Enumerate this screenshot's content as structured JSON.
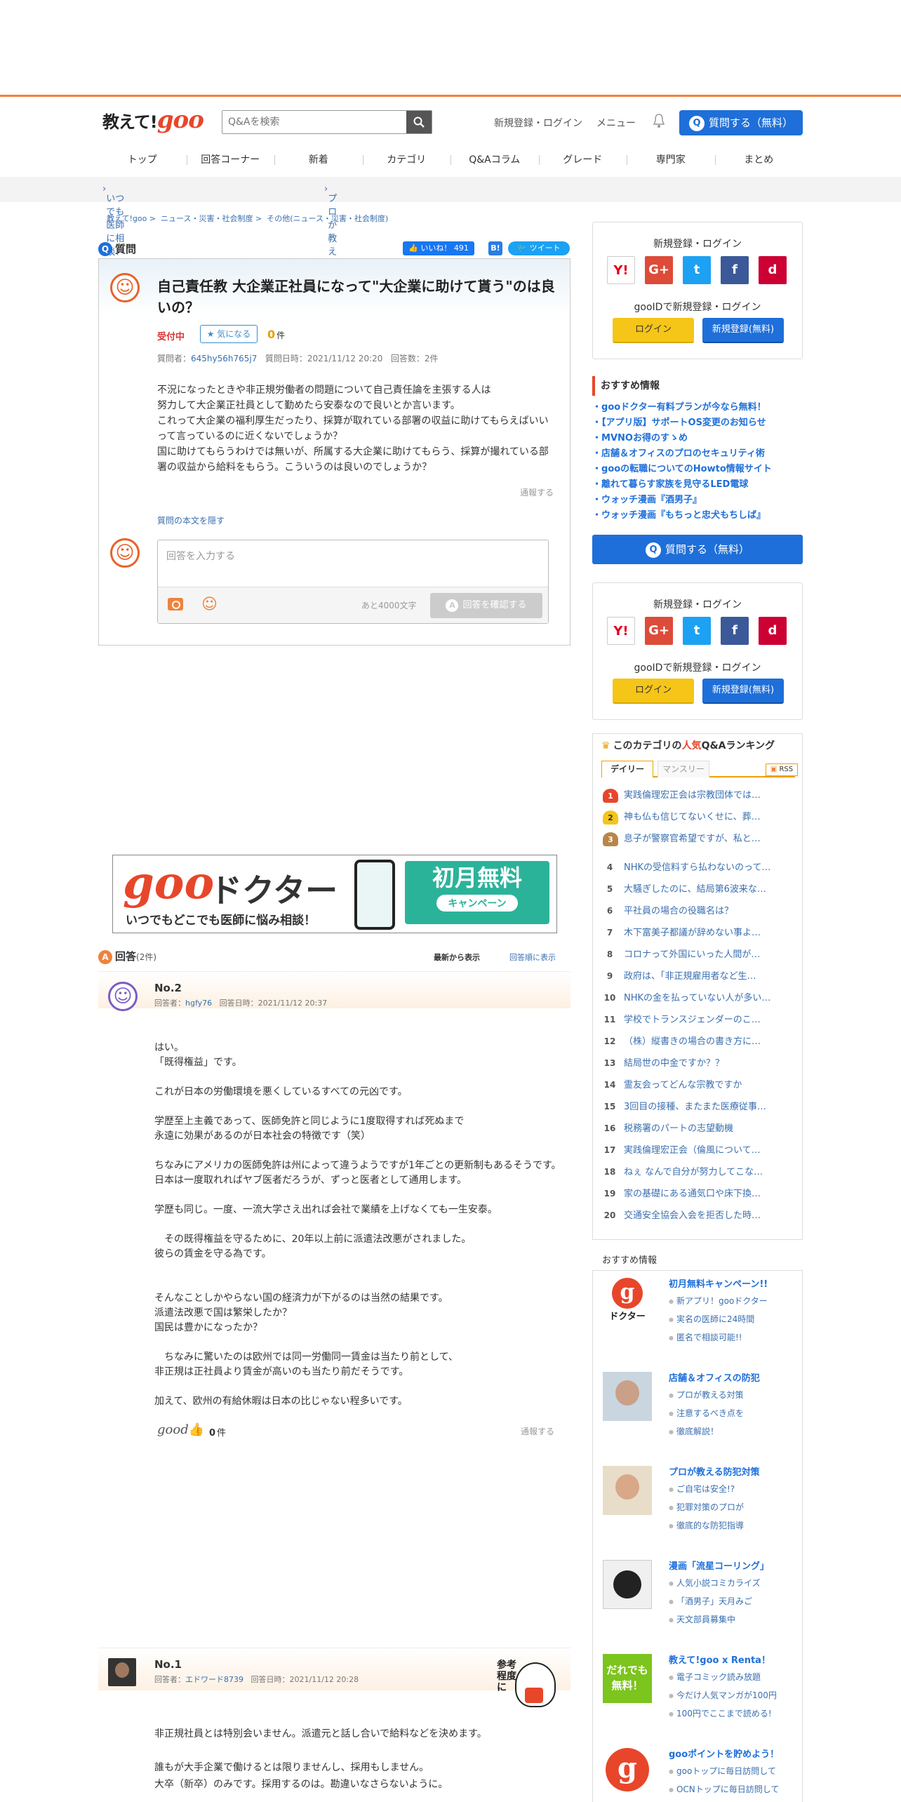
{
  "header": {
    "logo_part1": "教えて!",
    "logo_part2": "goo",
    "search_placeholder": "Q&Aを検索",
    "signup_login": "新規登録・ログイン",
    "menu": "メニュー",
    "ask_button": "質問する（無料）",
    "ask_icon": "Q"
  },
  "nav": [
    "トップ",
    "回答コーナー",
    "新着",
    "カテゴリ",
    "Q&Aコラム",
    "グレード",
    "専門家",
    "まとめ"
  ],
  "subbar": {
    "link1": "いつでも医師に相談、gooドクター",
    "link2": "プロが教える店舗＆オフィスのセキュリティ対策術"
  },
  "breadcrumb": {
    "home": "教えて!goo",
    "cat1": "ニュース・災害・社会制度",
    "cat2": "その他(ニュース・災害・社会制度)",
    "sep": ">"
  },
  "question": {
    "label": "質問",
    "icon": "Q",
    "like_label": "いいね！",
    "like_count": "491",
    "hatena": "B!",
    "tweet": "ツイート",
    "title": "自己責任教 大企業正社員になって\"大企業に助けて貰う\"のは良いの？",
    "status": "受付中",
    "fav_label": "気になる",
    "fav_count": "0",
    "fav_unit": "件",
    "meta_asker_label": "質問者：",
    "meta_asker": "645hy56h765j7",
    "meta_date": "質問日時：2021/11/12 20:20",
    "meta_answers": "回答数：2件",
    "body": "不況になったときや非正規労働者の問題について自己責任論を主張する人は\n努力して大企業正社員として勤めたら安泰なので良いとか言います。\nこれって大企業の福利厚生だったり、採算が取れている部署の収益に助けてもらえばいいって言っているのに近くないでしょうか？\n国に助けてもらうわけでは無いが、所属する大企業に助けてもらう、採算が撮れている部署の収益から給料をもらう。こういうのは良いのでしょうか？",
    "report": "通報する",
    "hide_body": "質問の本文を隠す",
    "answer_placeholder": "回答を入力する",
    "remaining": "あと4000文字",
    "confirm_icon": "A",
    "confirm": "回答を確認する"
  },
  "banner": {
    "brand": "goo",
    "title": "ドクター",
    "tagline": "いつでもどこでも医師に悩み相談！",
    "free": "初月無料",
    "campaign": "キャンペーン"
  },
  "answers": {
    "label": "回答",
    "icon": "A",
    "count": "(2件)",
    "sort_new": "最新から表示",
    "sort_old": "回答順に表示",
    "items": [
      {
        "no": "No.2",
        "answerer_label": "回答者：",
        "answerer": "hgfy76",
        "date": "回答日時：2021/11/12 20:37",
        "body": "はい。\n「既得権益」です。\n\nこれが日本の労働環境を悪くしているすべての元凶です。\n\n学歴至上主義であって、医師免許と同じように1度取得すれば死ぬまで\n永遠に効果があるのが日本社会の特徴です（笑）\n\nちなみにアメリカの医師免許は州によって違うようですが1年ごとの更新制もあるそうです。日本は一度取れればヤブ医者だろうが、ずっと医者として通用します。\n\n学歴も同じ。一度、一流大学さえ出れば会社で業績を上げなくても一生安泰。\n\n　その既得権益を守るために、20年以上前に派遣法改悪がされました。\n彼らの賃金を守る為です。\n\n\nそんなことしかやらない国の経済力が下がるのは当然の結果です。\n派遣法改悪で国は繁栄したか？\n国民は豊かになったか？\n\n　ちなみに驚いたのは欧州では同一労働同一賃金は当たり前として、\n非正規は正社員より賃金が高いのも当たり前だそうです。\n\n加えて、欧州の有給休暇は日本の比じゃない程多いです。",
        "good": "good",
        "good_count": "0",
        "good_unit": "件",
        "report": "通報する"
      },
      {
        "no": "No.1",
        "answerer_label": "回答者：",
        "answerer": "エドワード8739",
        "date": "回答日時：2021/11/12 20:28",
        "stamp": "参考程度に",
        "body": "非正規社員とは特別会いません。派遣元と話し合いで給料などを決めます。\n\n誰もが大手企業で働けるとは限りませんし、採用もしません。\n大卒（新卒）のみです。採用するのは。勘違いなさらないように。"
      }
    ]
  },
  "side": {
    "login_title": "新規登録・ログイン",
    "sns": [
      "Y!",
      "G+",
      "t",
      "f",
      "d"
    ],
    "goo_id": "gooIDで新規登録・ログイン",
    "login": "ログイン",
    "register": "新規登録(無料)",
    "reco_title": "おすすめ情報",
    "reco_items": [
      "gooドクター有料プランが今なら無料！",
      "【アプリ版】サポートOS変更のお知らせ",
      "MVNOお得のすゝめ",
      "店舗＆オフィスのプロのセキュリティ術",
      "gooの転職についてのHowto情報サイト",
      "離れて暮らす家族を見守るLED電球",
      "ウォッチ漫画『酒男子』",
      "ウォッチ漫画『もちっと忠犬もちしば』"
    ],
    "ask_button": "質問する（無料）",
    "ranking_title_a": "このカテゴリの",
    "ranking_title_b": "人気",
    "ranking_title_c": "Q&Aランキング",
    "tab_daily": "デイリー",
    "tab_monthly": "マンスリー",
    "rss": "RSS",
    "ranking": [
      {
        "n": "1",
        "t": "実践倫理宏正会は宗教団体では…"
      },
      {
        "n": "2",
        "t": "神も仏も信じてないくせに、葬…"
      },
      {
        "n": "3",
        "t": "息子が警察官希望ですが、私と…"
      },
      {
        "n": "4",
        "t": "NHKの受信料すら払わないのって…"
      },
      {
        "n": "5",
        "t": "大騒ぎしたのに、結局第6波来な…"
      },
      {
        "n": "6",
        "t": "平社員の場合の役職名は？"
      },
      {
        "n": "7",
        "t": "木下富美子都議が辞めない事よ…"
      },
      {
        "n": "8",
        "t": "コロナって外国にいった人間が…"
      },
      {
        "n": "9",
        "t": "政府は、「非正規雇用者など生…"
      },
      {
        "n": "10",
        "t": "NHKの金を払っていない人が多い…"
      },
      {
        "n": "11",
        "t": "学校でトランスジェンダーのこ…"
      },
      {
        "n": "12",
        "t": "（株）縦書きの場合の書き方に…"
      },
      {
        "n": "13",
        "t": "結局世の中金ですか？？"
      },
      {
        "n": "14",
        "t": "霊友会ってどんな宗教ですか"
      },
      {
        "n": "15",
        "t": "3回目の接種、またまた医療従事…"
      },
      {
        "n": "16",
        "t": "税務署のパートの志望動機"
      },
      {
        "n": "17",
        "t": "実践倫理宏正会（倫風について…"
      },
      {
        "n": "18",
        "t": "ねぇ なんで自分が努力してこな…"
      },
      {
        "n": "19",
        "t": "家の基礎にある通気口や床下換…"
      },
      {
        "n": "20",
        "t": "交通安全協会入会を拒否した時…"
      }
    ],
    "reco2_label": "おすすめ情報",
    "reco2": [
      {
        "title": "初月無料キャンペーン!!",
        "subs": [
          "新アプリ！gooドクター",
          "実名の医師に24時間",
          "匿名で相談可能!!"
        ],
        "img_label": "ドクター"
      },
      {
        "title": "店舗＆オフィスの防犯",
        "subs": [
          "プロが教える対策",
          "注意するべき点を",
          "徹底解説！"
        ]
      },
      {
        "title": "プロが教える防犯対策",
        "subs": [
          "ご自宅は安全!?",
          "犯罪対策のプロが",
          "徹底的な防犯指導"
        ]
      },
      {
        "title": "漫画「流星コーリング」",
        "subs": [
          "人気小説コミカライズ",
          "「酒男子」天月みご",
          "天文部員募集中"
        ]
      },
      {
        "title": "教えて!goo x Renta！",
        "subs": [
          "電子コミック読み放題",
          "今だけ人気マンガが100円",
          "100円でここまで読める!"
        ],
        "img_label": "だれでも無料！"
      },
      {
        "title": "gooポイントを貯めよう！",
        "subs": [
          "gooトップに毎日訪問して",
          "OCNトップに毎日訪問して"
        ]
      }
    ]
  }
}
